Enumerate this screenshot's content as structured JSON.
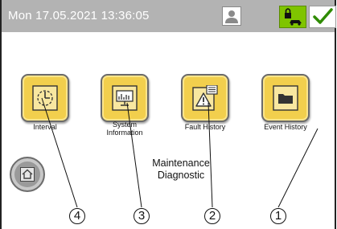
{
  "status_bar": {
    "datetime": "Mon 17.05.2021  13:36:05",
    "user_icon": "user-icon",
    "lock_icon": "lock-car-icon",
    "check_icon": "check-icon"
  },
  "menu": {
    "tiles": [
      {
        "label": "Interval",
        "icon": "clock-interval-icon"
      },
      {
        "label": "System\nInformation",
        "icon": "monitor-chart-icon"
      },
      {
        "label": "Fault History",
        "icon": "warning-document-icon"
      },
      {
        "label": "Event History",
        "icon": "folder-icon"
      }
    ],
    "home_icon": "home-icon"
  },
  "page": {
    "title_line1": "Maintenance",
    "title_line2": "Diagnostic"
  },
  "callouts": [
    "4",
    "3",
    "2",
    "1"
  ],
  "colors": {
    "tile": "#f2cf4d",
    "topbar": "#b3b3b3",
    "lock_button": "#7fc400",
    "check": "#2e8b00"
  }
}
